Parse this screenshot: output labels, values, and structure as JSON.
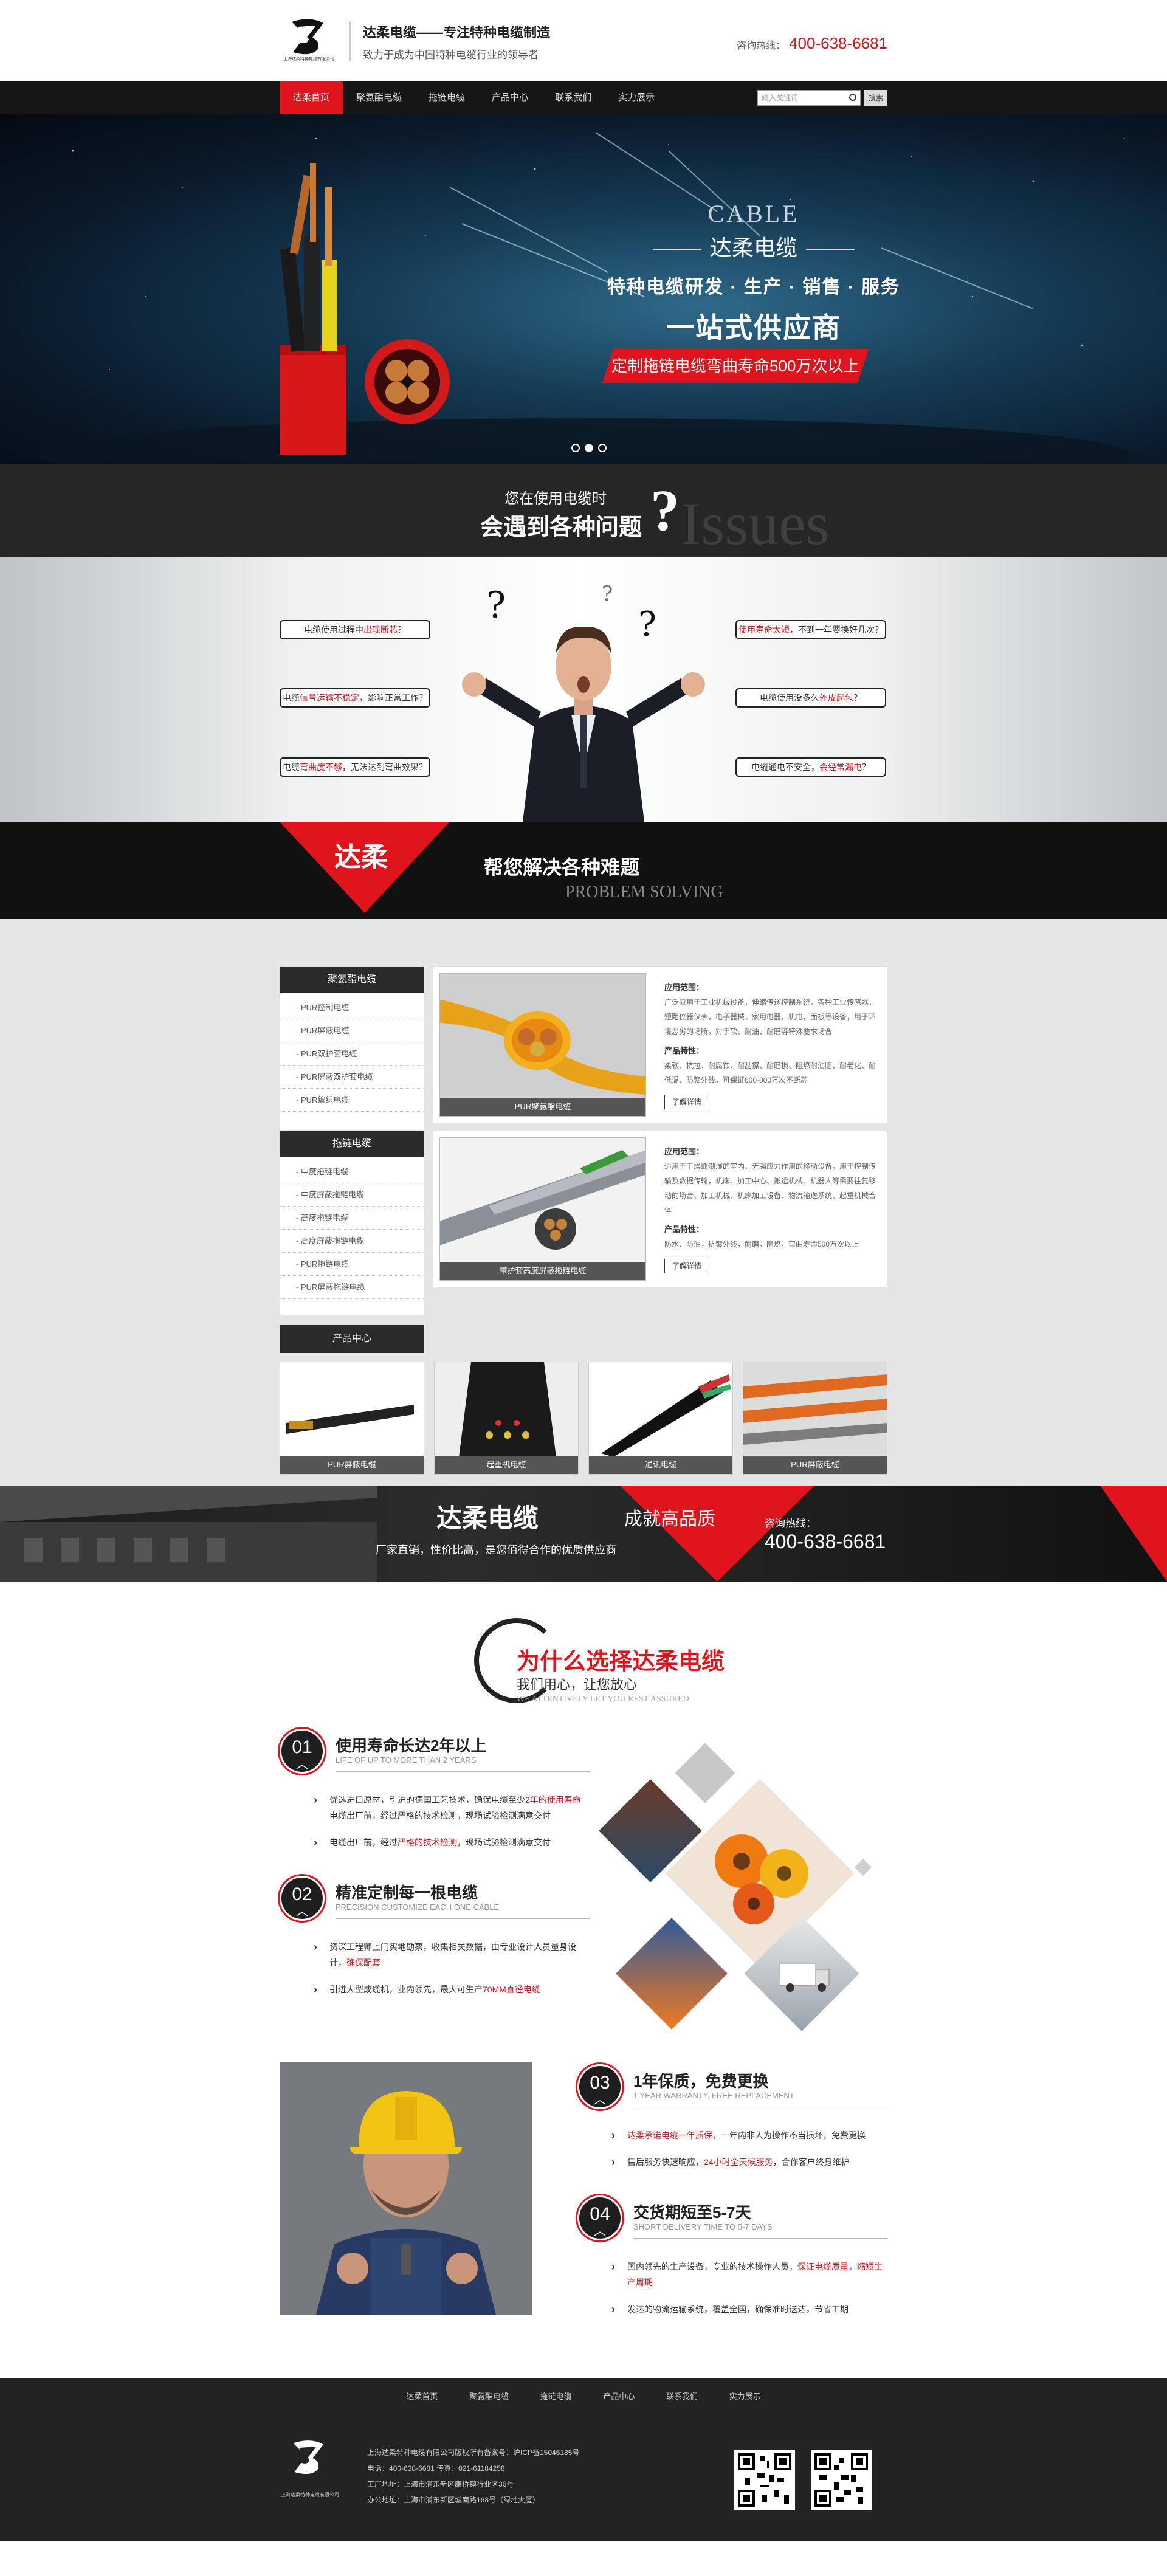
{
  "header": {
    "brand_title": "达柔电缆——专注特种电缆制造",
    "brand_sub": "致力于成为中国特种电缆行业的领导者",
    "logo_caption": "上海达柔特种电缆有限公司",
    "hotline_label": "咨询热线：",
    "hotline_number": "400-638-6681"
  },
  "nav": {
    "items": [
      "达柔首页",
      "聚氨酯电缆",
      "拖链电缆",
      "产品中心",
      "联系我们",
      "实力展示"
    ],
    "search_placeholder": "输入关键词",
    "search_button": "搜索"
  },
  "banner": {
    "en": "CABLE",
    "cn": "达柔电缆",
    "sub": "特种电缆研发 · 生产 · 销售 · 服务",
    "big": "一站式供应商",
    "tag": "定制拖链电缆弯曲寿命500万次以上"
  },
  "issues": {
    "line1": "您在使用电缆时",
    "line2": "会遇到各种问题",
    "qmark": "?",
    "ghost": "Issues",
    "left": [
      {
        "pre": "电缆使用过程中",
        "hl": "出现断芯",
        "post": "？"
      },
      {
        "pre": "电缆",
        "hl": "信号运输不稳定",
        "post": "，影响正常工作？"
      },
      {
        "pre": "电缆",
        "hl": "弯曲度不够",
        "post": "，无法达到弯曲效果？"
      }
    ],
    "right": [
      {
        "pre": "",
        "hl": "使用寿命太短",
        "post": "，不到一年要换好几次？"
      },
      {
        "pre": "电缆使用没多久",
        "hl": "外皮起包",
        "post": "？"
      },
      {
        "pre": "电缆通电不安全，",
        "hl": "会经常漏电",
        "post": "？"
      }
    ]
  },
  "solve": {
    "brand": "达柔",
    "title": "帮您解决各种难题",
    "en": "PROBLEM SOLVING"
  },
  "products": {
    "cat1": {
      "title": "聚氨酯电缆",
      "items": [
        "PUR控制电缆",
        "PUR屏蔽电缆",
        "PUR双护套电缆",
        "PUR屏蔽双护套电缆",
        "PUR编织电缆"
      ]
    },
    "cat2": {
      "title": "拖链电缆",
      "items": [
        "中度拖链电缆",
        "中度屏蔽拖链电缆",
        "高度拖链电缆",
        "高度屏蔽拖链电缆",
        "PUR拖链电缆",
        "PUR屏蔽拖链电缆"
      ]
    },
    "box1": {
      "caption": "PUR聚氨酯电缆",
      "app_title": "应用范围：",
      "app_text": "广泛应用于工业机械设备，伸缩传送控制系统，各种工业传感器，短距仪器仪表，电子器械，家用电器，机电，面板等设备，用于环境恶劣的场所，对于软、耐油、耐磨等特殊要求场合",
      "feat_title": "产品特性：",
      "feat_text": "柔软、抗拉、耐腐蚀、耐刮擦、耐磨损、阻燃耐油脂、耐老化、耐低温、防紫外线。可保证600-800万次不断芯",
      "more": "了解详情"
    },
    "box2": {
      "caption": "带护套高度屏蔽拖链电缆",
      "app_title": "应用范围：",
      "app_text": "适用于干燥或潮湿的室内，无强应力作用的移动设备，用于控制传输及数据传输，机床、加工中心、搬运机械、机器人等需要往复移动的场合、加工机械、机床加工设备、物流输送系统、起重机械合体",
      "feat_title": "产品特性：",
      "feat_text": "防水、防油，抗紫外线，耐磨，阻燃，弯曲寿命500万次以上",
      "more": "了解详情"
    },
    "center_title": "产品中心",
    "thumbs": [
      "PUR屏蔽电缆",
      "起重机电缆",
      "通讯电缆",
      "PUR屏蔽电缆"
    ]
  },
  "qband": {
    "t1": "达柔电缆",
    "t2": "厂家直销，性价比高，是您值得合作的优质供应商",
    "t3": "成就高品质",
    "t4": "咨询热线：",
    "t5": "400-638-6681"
  },
  "why": {
    "title": "为什么选择达柔电缆",
    "sub": "我们用心，让您放心",
    "en": "WE ATTENTIVELY LET YOU REST ASSURED",
    "reasons": [
      {
        "num": "01",
        "title": "使用寿命长达2年以上",
        "en": "LIFE OF UP TO MORE THAN 2 YEARS",
        "points": [
          {
            "pre": "优选进口原材，引进的德国工艺技术，确保电缆至少",
            "hl": "2年的使用寿命",
            "post": "电缆出厂前，经过严格的技术检测，现场试验检测满意交付"
          },
          {
            "pre": "电缆出厂前，经过",
            "hl": "严格的技术检测",
            "post": "，现场试验检测满意交付"
          }
        ]
      },
      {
        "num": "02",
        "title": "精准定制每一根电缆",
        "en": "PRECISION CUSTOMIZE EACH ONE CABLE",
        "points": [
          {
            "pre": "资深工程师上门实地勘察，收集相关数据，由专业设计人员量身设计，",
            "hl": "确保配套",
            "post": ""
          },
          {
            "pre": "引进大型成缆机，业内领先，最大可生产",
            "hl": "70MM直径电缆",
            "post": ""
          }
        ]
      },
      {
        "num": "03",
        "title": "1年保质，免费更换",
        "en": "1 YEAR WARRANTY, FREE REPLACEMENT",
        "points": [
          {
            "pre": "",
            "hl": "达柔承诺电缆一年质保",
            "post": "，一年内非人为操作不当损坏，免费更换"
          },
          {
            "pre": "售后服务快速响应，",
            "hl": "24小时全天候服务",
            "post": "，合作客户终身维护"
          }
        ]
      },
      {
        "num": "04",
        "title": "交货期短至5-7天",
        "en": "SHORT DELIVERY TIME TO 5-7 DAYS",
        "points": [
          {
            "pre": "国内领先的生产设备，专业的技术操作人员，",
            "hl": "保证电缆质量，缩短生产周期",
            "post": ""
          },
          {
            "pre": "发达的物流运输系统，覆盖全国，确保准时送达，节省工期",
            "hl": "",
            "post": ""
          }
        ]
      }
    ]
  },
  "footer": {
    "nav": [
      "达柔首页",
      "聚氨酯电缆",
      "拖链电缆",
      "产品中心",
      "联系我们",
      "实力展示"
    ],
    "company": "上海达柔特种电缆有限公司版权所有备案号：沪ICP备15046185号",
    "phone": "电话：400-638-6681    传真：021-61184258",
    "factory": "工厂地址：上海市浦东新区康桥镇行业区36号",
    "office": "办公地址：上海市浦东新区城南路168号（绿地大厦）",
    "logo_caption": "上海达柔特种电缆有限公司"
  }
}
